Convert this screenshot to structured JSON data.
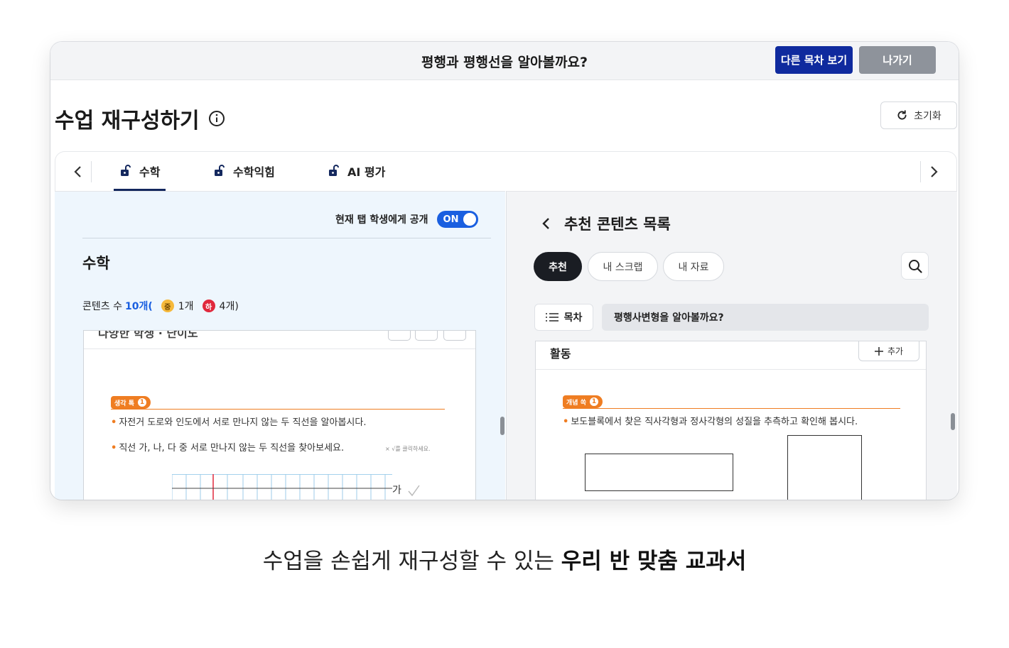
{
  "topbar": {
    "lesson_title": "평행과 평행선을 알아볼까요?",
    "other_toc_label": "다른 목차 보기",
    "exit_label": "나가기"
  },
  "page": {
    "title": "수업 재구성하기",
    "reset_label": "초기화"
  },
  "tabs": [
    {
      "label": "수학",
      "active": true
    },
    {
      "label": "수학익힘",
      "active": false
    },
    {
      "label": "AI 평가",
      "active": false
    }
  ],
  "left_panel": {
    "toggle_label": "현재 탭 학생에게 공개",
    "toggle_state": "ON",
    "heading": "수학",
    "count_prefix": "콘텐츠 수",
    "count_total": "10개(",
    "badge_mid": "중",
    "count_mid": "1개",
    "badge_low": "하",
    "count_low": "4개)",
    "doc": {
      "cut_title": "다양한 학생 · 난이도",
      "tag_label": "생각 톡",
      "tag_number": "1",
      "line1": "자전거 도로와 인도에서 서로 만나지 않는 두 직선을 알아봅시다.",
      "line2": "직선 가, 나, 다 중 서로 만나지 않는 두 직선을 찾아보세요.",
      "hint": "× √를 클릭하세요.",
      "line_label": "가"
    }
  },
  "right_panel": {
    "title": "추천 콘텐츠 목록",
    "chips": [
      "추천",
      "내 스크랩",
      "내 자료"
    ],
    "toc_label": "목차",
    "toc_value": "평행사변형을 알아볼까요?",
    "activity": {
      "label": "활동",
      "add_label": "추가",
      "tag_label": "개념 쏙",
      "tag_number": "1",
      "line1": "보도블록에서 찾은 직사각형과 정사각형의 성질을 추측하고 확인해 봅시다."
    }
  },
  "caption": {
    "normal": "수업을 손쉽게 재구성할 수 있는 ",
    "bold": "우리 반 맞춤 교과서"
  },
  "colors": {
    "brand_navy": "#0f2a9e",
    "toggle_blue": "#1a5fe0",
    "accent_orange": "#ef7d22",
    "badge_yellow": "#f6b93b",
    "badge_red": "#e0283c"
  },
  "icons": [
    "info-icon",
    "refresh-icon",
    "chevron-left-icon",
    "chevron-right-icon",
    "unlock-icon",
    "search-icon",
    "list-icon",
    "plus-icon"
  ]
}
